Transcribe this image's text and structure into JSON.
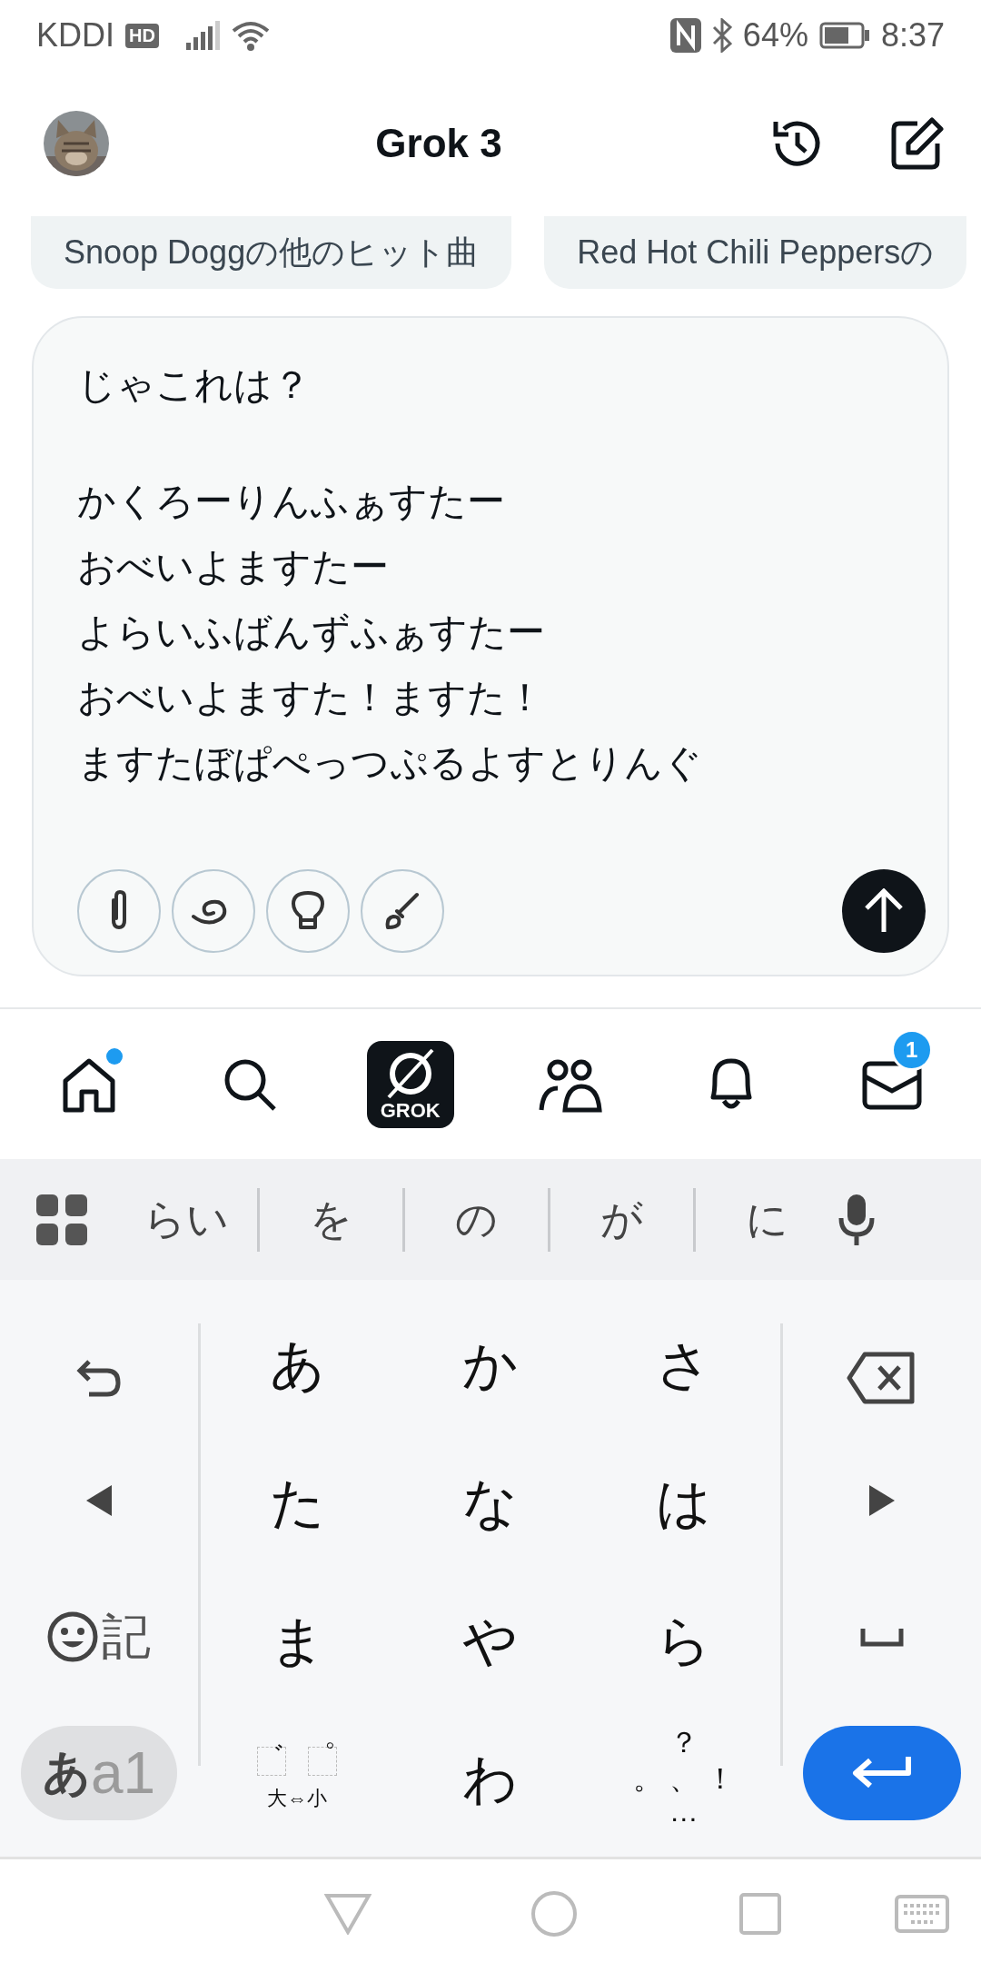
{
  "status_bar": {
    "carrier": "KDDI",
    "hd_badge": "HD",
    "battery_percent": "64%",
    "time": "8:37"
  },
  "header": {
    "title": "Grok 3"
  },
  "suggestion_chips": [
    "Snoop Doggの他のヒット曲",
    "Red Hot Chili Peppersの"
  ],
  "composer": {
    "question": "じゃこれは？",
    "lyric_lines": [
      "かくろーりんふぁすたー",
      "おべいよますたー",
      "よらいふばんずふぁすたー",
      "おべいよますた！ますた！",
      "ますたぼぱぺっつぷるよすとりんぐ"
    ],
    "tools": [
      {
        "kind": "attach"
      },
      {
        "kind": "spiral"
      },
      {
        "kind": "bulb"
      },
      {
        "kind": "brush"
      }
    ]
  },
  "bottom_nav": [
    {
      "kind": "home",
      "dot": true
    },
    {
      "kind": "search",
      "dot": false
    },
    {
      "kind": "grok",
      "label": "GROK",
      "dot": false
    },
    {
      "kind": "people",
      "dot": false
    },
    {
      "kind": "bell",
      "dot": false
    },
    {
      "kind": "mail",
      "dot": false,
      "badge": "1"
    }
  ],
  "keyboard": {
    "candidates": [
      "らい",
      "を",
      "の",
      "が",
      "に"
    ],
    "symbol_key": "記",
    "mode_key": {
      "primary": "あ",
      "secondary": "a1"
    },
    "kana_rows": [
      [
        "あ",
        "か",
        "さ"
      ],
      [
        "た",
        "な",
        "は"
      ],
      [
        "ま",
        "や",
        "ら"
      ]
    ],
    "dakuten_key": {
      "marks": [
        "゛",
        "゜"
      ],
      "caption": "大⇔小"
    },
    "last_kana": "わ",
    "punct_key": {
      "top": "？",
      "left": "。",
      "middle": "、",
      "right": "！",
      "bottom": "…"
    }
  }
}
